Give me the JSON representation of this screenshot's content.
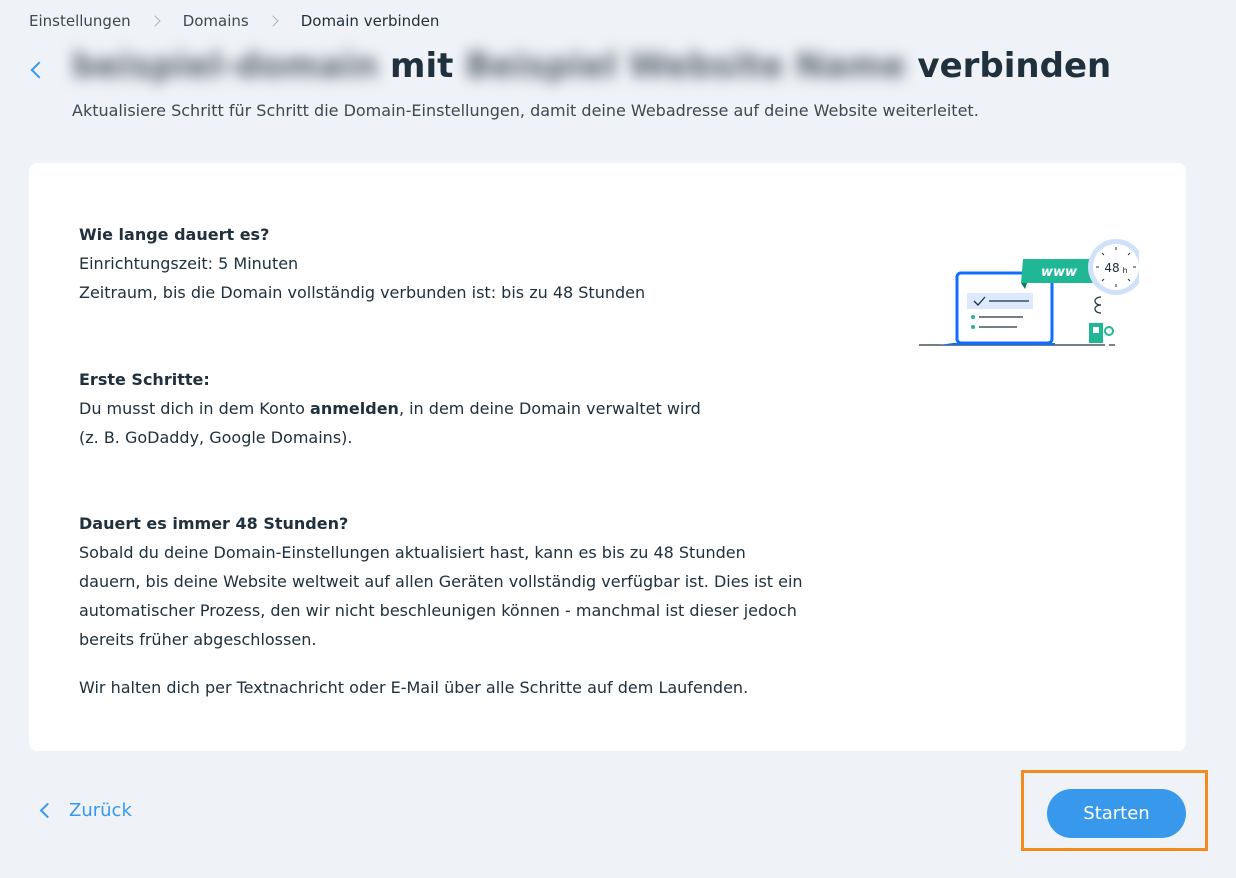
{
  "breadcrumb": {
    "items": [
      "Einstellungen",
      "Domains",
      "Domain verbinden"
    ]
  },
  "header": {
    "title_domain_blurred": "beispiel-domain",
    "title_mid": "mit",
    "title_site_blurred": "Beispiel Website Name",
    "title_end": "verbinden",
    "subtitle": "Aktualisiere Schritt für Schritt die Domain-Einstellungen, damit deine Webadresse auf deine Website weiterleitet."
  },
  "card": {
    "section1": {
      "heading": "Wie lange dauert es?",
      "line1": "Einrichtungszeit: 5 Minuten",
      "line2": "Zeitraum, bis die Domain vollständig verbunden ist: bis zu 48 Stunden"
    },
    "section2": {
      "heading": "Erste Schritte:",
      "text_before": "Du musst dich in dem Konto ",
      "text_bold": "anmelden",
      "text_after": ", in dem deine Domain verwaltet wird",
      "line2": "(z. B. GoDaddy, Google Domains)."
    },
    "section3": {
      "heading": "Dauert es immer 48 Stunden?",
      "line1": "Sobald du deine Domain-Einstellungen aktualisiert hast, kann es bis zu 48 Stunden",
      "line2": "dauern, bis deine Website weltweit auf allen Geräten vollständig verfügbar ist. Dies ist ein",
      "line3": "automatischer Prozess, den wir nicht beschleunigen können - manchmal ist dieser jedoch",
      "line4": "bereits früher abgeschlossen."
    },
    "section4": {
      "text": "Wir halten dich per Textnachricht oder E-Mail über alle Schritte auf dem Laufenden."
    },
    "illustration": {
      "banner_text": "www",
      "clock_text": "48",
      "clock_unit": "h"
    }
  },
  "footer": {
    "back_label": "Zurück",
    "start_label": "Starten"
  },
  "colors": {
    "accent": "#3899ec",
    "highlight": "#f28c1f",
    "background": "#eff2f6",
    "illustration_green": "#20b894"
  },
  "icons": [
    "chevron-left-icon",
    "chevron-right-icon"
  ]
}
